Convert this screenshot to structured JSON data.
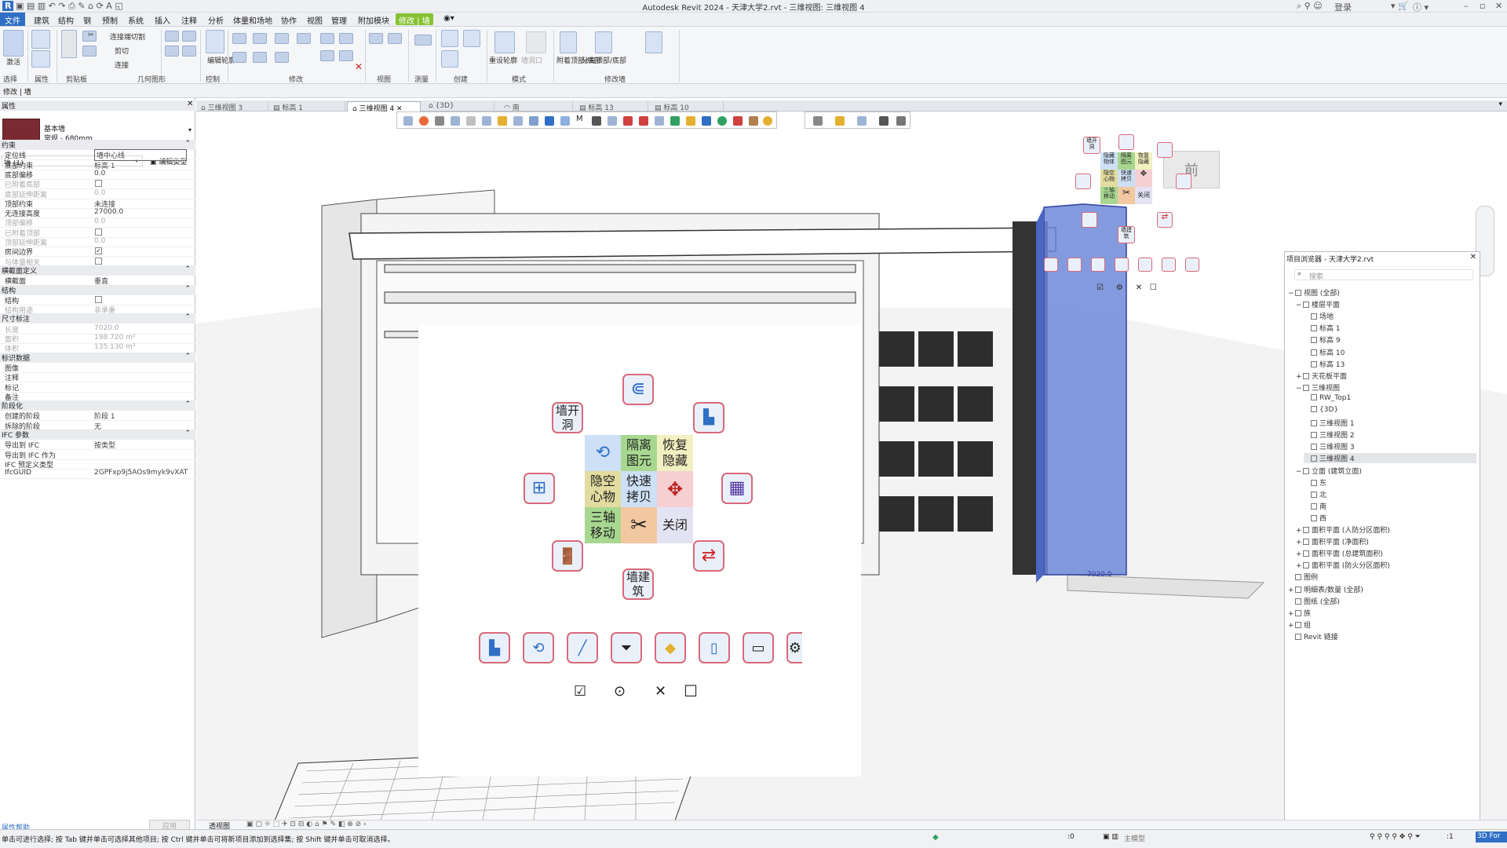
{
  "title": "Autodesk Revit 2024 - 天津大学2.rvt - 三维视图: 三维视图 4",
  "app_logo": "R",
  "login_label": "登录",
  "menu": [
    "文件",
    "建筑",
    "结构",
    "钢",
    "预制",
    "系统",
    "插入",
    "注释",
    "分析",
    "体量和场地",
    "协作",
    "视图",
    "管理",
    "附加模块",
    "修改 | 墙"
  ],
  "ribbon": {
    "tools": [
      "连接端切割",
      "剪切",
      "连接",
      "修改",
      "激活",
      "编辑轮廓",
      "重设轮廓",
      "墙洞口",
      "附着顶部/底部",
      "分离顶部/底部"
    ],
    "panels": [
      "选择",
      "属性",
      "剪贴板",
      "几何图形",
      "控制",
      "修改",
      "视图",
      "测量",
      "创建",
      "模式",
      "修改墙"
    ]
  },
  "optionbar": {
    "label": "修改 | 墙"
  },
  "properties": {
    "header": "属性",
    "type_family": "基本墙",
    "type_name": "常规 - 680mm",
    "instance_filter": "墙 (1)",
    "edit_type": "编辑类型",
    "help": "属性帮助",
    "apply": "应用",
    "sections": [
      {
        "name": "约束",
        "rows": [
          {
            "k": "定位线",
            "v": "墙中心线",
            "dis": false,
            "box": true
          },
          {
            "k": "底部约束",
            "v": "标高 1",
            "dis": false
          },
          {
            "k": "底部偏移",
            "v": "0.0",
            "dis": false
          },
          {
            "k": "已附着底部",
            "v": "",
            "dis": true,
            "cb": "off"
          },
          {
            "k": "底部延伸距离",
            "v": "0.0",
            "dis": true
          },
          {
            "k": "顶部约束",
            "v": "未连接",
            "dis": false
          },
          {
            "k": "无连接高度",
            "v": "27000.0",
            "dis": false
          },
          {
            "k": "顶部偏移",
            "v": "0.0",
            "dis": true
          },
          {
            "k": "已附着顶部",
            "v": "",
            "dis": true,
            "cb": "off"
          },
          {
            "k": "顶部延伸距离",
            "v": "0.0",
            "dis": true
          },
          {
            "k": "房间边界",
            "v": "",
            "dis": false,
            "cb": "on"
          },
          {
            "k": "与体量相关",
            "v": "",
            "dis": true,
            "cb": "off"
          }
        ]
      },
      {
        "name": "横截面定义",
        "rows": [
          {
            "k": "横截面",
            "v": "垂直",
            "dis": false
          }
        ]
      },
      {
        "name": "结构",
        "rows": [
          {
            "k": "结构",
            "v": "",
            "dis": false,
            "cb": "off"
          },
          {
            "k": "结构用途",
            "v": "非承重",
            "dis": true
          }
        ]
      },
      {
        "name": "尺寸标注",
        "rows": [
          {
            "k": "长度",
            "v": "7020.0",
            "dis": true
          },
          {
            "k": "面积",
            "v": "198.720 m²",
            "dis": true
          },
          {
            "k": "体积",
            "v": "135.130 m³",
            "dis": true
          }
        ]
      },
      {
        "name": "标识数据",
        "rows": [
          {
            "k": "图像",
            "v": "",
            "dis": false
          },
          {
            "k": "注释",
            "v": "",
            "dis": false
          },
          {
            "k": "标记",
            "v": "",
            "dis": false
          },
          {
            "k": "备注",
            "v": "",
            "dis": false
          }
        ]
      },
      {
        "name": "阶段化",
        "rows": [
          {
            "k": "创建的阶段",
            "v": "阶段 1",
            "dis": false
          },
          {
            "k": "拆除的阶段",
            "v": "无",
            "dis": false
          }
        ]
      },
      {
        "name": "IFC 参数",
        "rows": [
          {
            "k": "导出到 IFC",
            "v": "按类型",
            "dis": false
          },
          {
            "k": "导出到 IFC 作为",
            "v": "",
            "dis": false
          },
          {
            "k": "IFC 预定义类型",
            "v": "",
            "dis": false
          },
          {
            "k": "IfcGUID",
            "v": "2GPFxp9j5AOs9myk9vXAT",
            "dis": false
          }
        ]
      }
    ]
  },
  "tabs": [
    {
      "label": "三维视图 3",
      "active": false
    },
    {
      "label": "标高 1",
      "active": false
    },
    {
      "label": "三维视图 4",
      "active": true
    },
    {
      "label": "{3D}",
      "active": false
    },
    {
      "label": "南",
      "active": false
    },
    {
      "label": "标高 13",
      "active": false
    },
    {
      "label": "标高 10",
      "active": false
    }
  ],
  "viewcube_label": "前",
  "radial_menu": {
    "top": "",
    "wall_opening": "墙开\n洞",
    "isolate": "隔离\n图元",
    "restore_hidden": "恢复\n隐藏",
    "hollow": "隐空\n心物",
    "quick_copy": "快速\n拷贝",
    "triaxial_move": "三轴\n移动",
    "close": "关闭",
    "wall_building": "墙建\n筑",
    "hollow_prefix": "隐空",
    "grid_colors": {
      "isolate": "#a8d890",
      "restore": "#f2f0c0",
      "hollow": "#e2dca0",
      "copy": "#cde0f5",
      "move": "#f5cfd2",
      "triaxial": "#a8d890",
      "cut": "#f2c8a0",
      "close": "#e3e3f3",
      "tl": "#cde0f5"
    }
  },
  "mini_menu": {
    "wall_opening": "墙开\n洞",
    "isolate": "隔离\n图元",
    "restore": "恢复\n隐藏",
    "hollow": "隐空\n心物",
    "copy": "快速\n拷贝",
    "triaxial": "三轴\n移动",
    "close": "关闭",
    "wall_building": "墙建\n筑",
    "top_left": "隐藏\n物体"
  },
  "dim_label": "7020.0",
  "browser": {
    "title": "项目浏览器 - 天津大学2.rvt",
    "search_placeholder": "搜索",
    "items": [
      {
        "t": "视图 (全部)",
        "lvl": 0,
        "sign": "−"
      },
      {
        "t": "楼层平面",
        "lvl": 1,
        "sign": "−"
      },
      {
        "t": "场地",
        "lvl": 2
      },
      {
        "t": "标高 1",
        "lvl": 2
      },
      {
        "t": "标高 9",
        "lvl": 2
      },
      {
        "t": "标高 10",
        "lvl": 2
      },
      {
        "t": "标高 13",
        "lvl": 2
      },
      {
        "t": "天花板平面",
        "lvl": 1,
        "sign": "+"
      },
      {
        "t": "三维视图",
        "lvl": 1,
        "sign": "−"
      },
      {
        "t": "RW_Top1",
        "lvl": 2
      },
      {
        "t": "{3D}",
        "lvl": 2
      },
      {
        "t": "三维视图 1",
        "lvl": 2
      },
      {
        "t": "三维视图 2",
        "lvl": 2
      },
      {
        "t": "三维视图 3",
        "lvl": 2
      },
      {
        "t": "三维视图 4",
        "lvl": 2,
        "sel": true
      },
      {
        "t": "立面 (建筑立面)",
        "lvl": 1,
        "sign": "−"
      },
      {
        "t": "东",
        "lvl": 2
      },
      {
        "t": "北",
        "lvl": 2
      },
      {
        "t": "南",
        "lvl": 2
      },
      {
        "t": "西",
        "lvl": 2
      },
      {
        "t": "面积平面 (人防分区面积)",
        "lvl": 1,
        "sign": "+"
      },
      {
        "t": "面积平面 (净面积)",
        "lvl": 1,
        "sign": "+"
      },
      {
        "t": "面积平面 (总建筑面积)",
        "lvl": 1,
        "sign": "+"
      },
      {
        "t": "面积平面 (防火分区面积)",
        "lvl": 1,
        "sign": "+"
      },
      {
        "t": "图例",
        "lvl": 0
      },
      {
        "t": "明细表/数量 (全部)",
        "lvl": 0,
        "sign": "+"
      },
      {
        "t": "图纸 (全部)",
        "lvl": 0
      },
      {
        "t": "族",
        "lvl": 0,
        "sign": "+"
      },
      {
        "t": "组",
        "lvl": 0,
        "sign": "+"
      },
      {
        "t": "Revit 链接",
        "lvl": 0
      }
    ]
  },
  "viewctl": {
    "mode": "透视图"
  },
  "status": {
    "hint": "单击可进行选择; 按 Tab 键并单击可选择其他项目; 按 Ctrl 键并单击可将新项目添加到选择集; 按 Shift 键并单击可取消选择。",
    "zero": ":0",
    "model": "主模型",
    "filter": ":1",
    "right_tab": "3D For"
  }
}
